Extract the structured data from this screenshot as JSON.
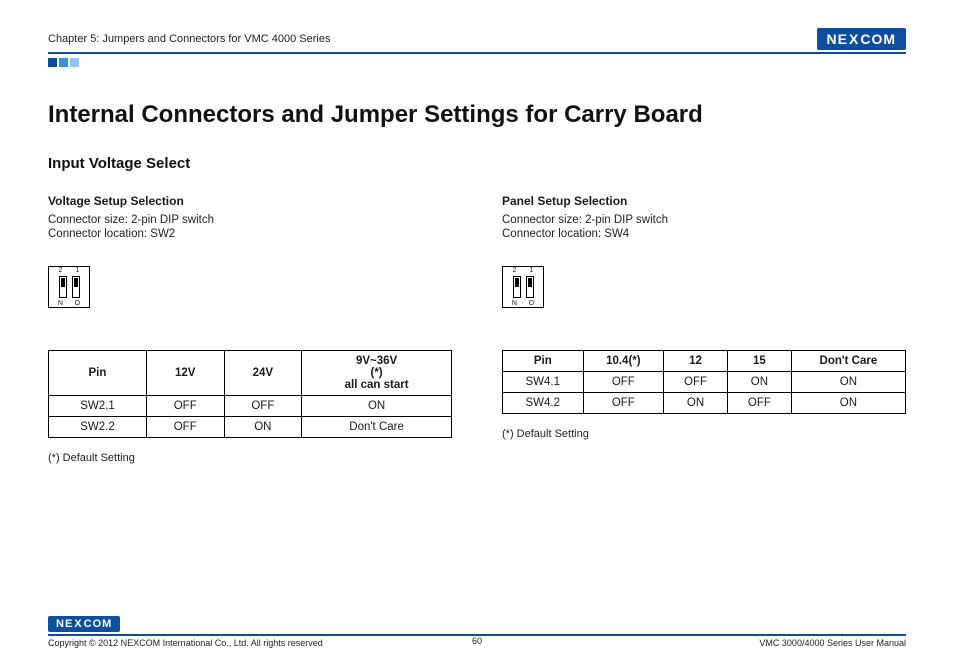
{
  "header": {
    "chapter": "Chapter 5: Jumpers and Connectors for VMC 4000 Series",
    "brand": "NEXCOM"
  },
  "page_title": "Internal Connectors and Jumper Settings for Carry Board",
  "section_title": "Input Voltage Select",
  "left": {
    "sub_title": "Voltage Setup Selection",
    "conn_size": "Connector size: 2-pin DIP switch",
    "conn_loc": "Connector location: SW2",
    "dip_top_left": "2",
    "dip_top_right": "1",
    "dip_bot_left": "N",
    "dip_bot_right": "O",
    "table": {
      "headers": [
        "Pin",
        "12V",
        "24V",
        "9V~36V\n(*)\nall can start"
      ],
      "rows": [
        [
          "SW2.1",
          "OFF",
          "OFF",
          "ON"
        ],
        [
          "SW2.2",
          "OFF",
          "ON",
          "Don't Care"
        ]
      ]
    },
    "note": "(*) Default Setting"
  },
  "right": {
    "sub_title": "Panel Setup Selection",
    "conn_size": "Connector size: 2-pin DIP switch",
    "conn_loc": "Connector location: SW4",
    "dip_top_left": "2",
    "dip_top_right": "1",
    "dip_bot_left": "N",
    "dip_bot_right": "O",
    "table": {
      "headers": [
        "Pin",
        "10.4(*)",
        "12",
        "15",
        "Don't Care"
      ],
      "rows": [
        [
          "SW4.1",
          "OFF",
          "OFF",
          "ON",
          "ON"
        ],
        [
          "SW4.2",
          "OFF",
          "ON",
          "OFF",
          "ON"
        ]
      ]
    },
    "note": "(*) Default Setting"
  },
  "footer": {
    "copyright": "Copyright © 2012 NEXCOM International Co., Ltd. All rights reserved",
    "page_num": "60",
    "doc_title": "VMC 3000/4000 Series User Manual"
  }
}
